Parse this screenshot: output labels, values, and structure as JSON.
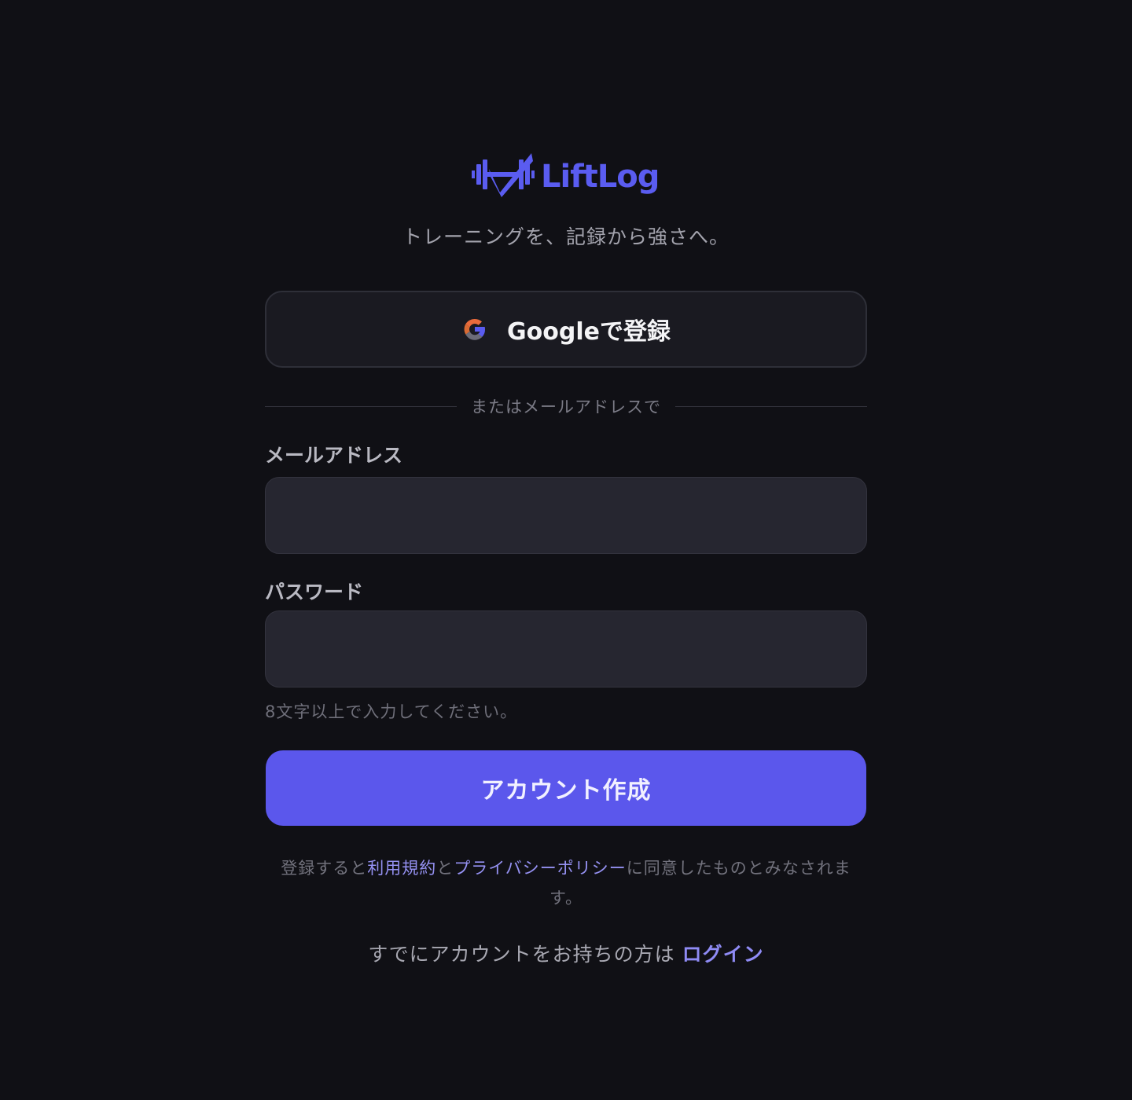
{
  "brand": {
    "name": "LiftLog",
    "color": "#5a5cf0",
    "tagline": "トレーニングを、記録から強さへ。"
  },
  "google": {
    "label": "Googleで登録",
    "icon": "google-g-icon"
  },
  "divider": {
    "text": "またはメールアドレスで"
  },
  "form": {
    "email": {
      "label": "メールアドレス",
      "value": "",
      "placeholder": ""
    },
    "password": {
      "label": "パスワード",
      "value": "",
      "placeholder": "",
      "hint": "8文字以上で入力してください。"
    },
    "submit_label": "アカウント作成",
    "submit_color": "#5b57ec"
  },
  "terms": {
    "prefix": "登録すると",
    "terms_link": "利用規約",
    "conjunction": "と",
    "privacy_link": "プライバシーポリシー",
    "suffix": "に同意したものとみなされます。"
  },
  "login": {
    "prompt": "すでにアカウントをお持ちの方は",
    "link": "ログイン"
  }
}
